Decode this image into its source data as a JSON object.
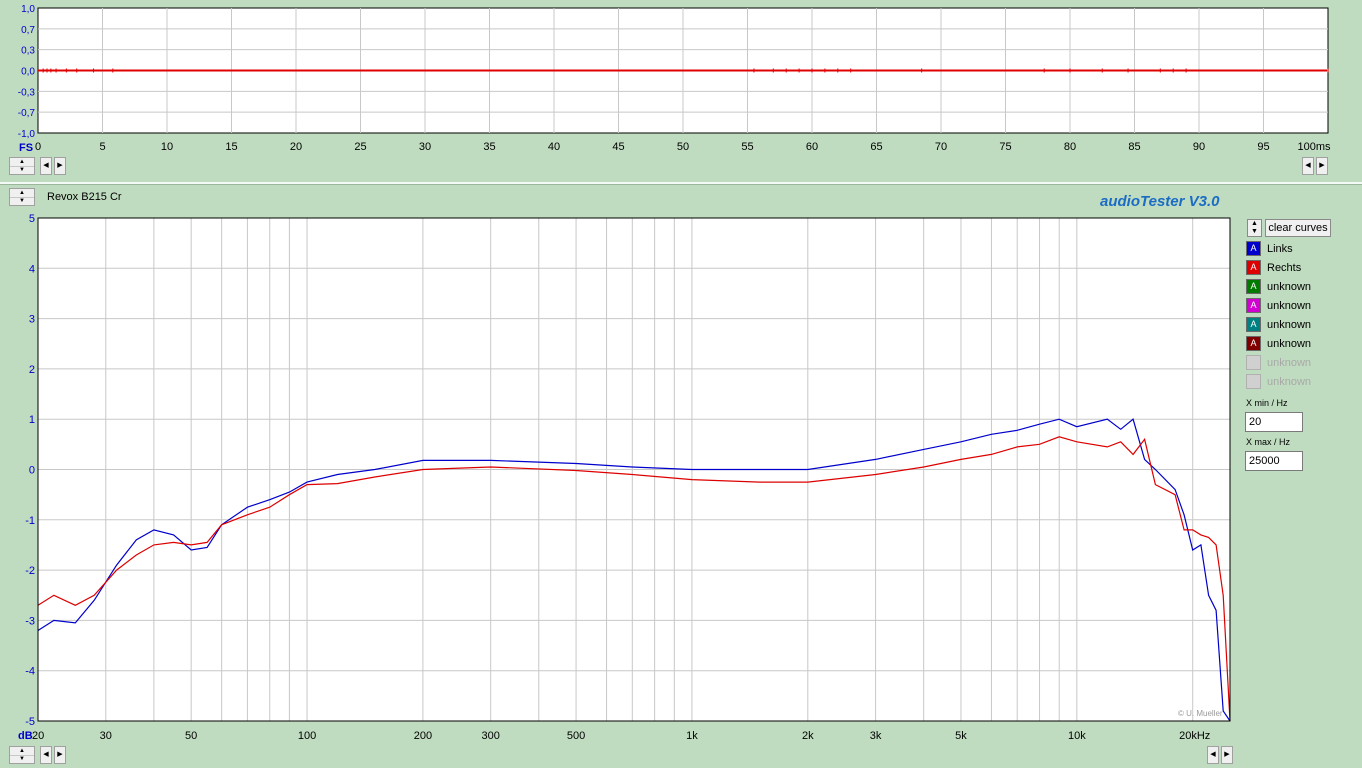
{
  "time_plot": {
    "y_unit": "FS",
    "x_unit": "ms",
    "y_ticks": [
      "1,0",
      "0,7",
      "0,3",
      "0,0",
      "-0,3",
      "-0,7",
      "-1,0"
    ],
    "x_ticks": [
      "0",
      "5",
      "10",
      "15",
      "20",
      "25",
      "30",
      "35",
      "40",
      "45",
      "50",
      "55",
      "60",
      "65",
      "70",
      "75",
      "80",
      "85",
      "90",
      "95",
      "100ms"
    ],
    "trace_color": "#e00000"
  },
  "file_name": "Revox B215 Cr",
  "brand": "audioTester  V3.0",
  "freq_plot": {
    "y_unit": "dB",
    "y_ticks": [
      "5",
      "4",
      "3",
      "2",
      "1",
      "0",
      "-1",
      "-2",
      "-3",
      "-4",
      "-5"
    ],
    "x_ticks": [
      "20",
      "30",
      "50",
      "100",
      "200",
      "300",
      "500",
      "1k",
      "2k",
      "3k",
      "5k",
      "10k",
      "20kHz"
    ],
    "copyright": "© U. Mueller"
  },
  "controls": {
    "clear_label": "clear curves",
    "xmin_label": "X min / Hz",
    "xmin_value": "20",
    "xmax_label": "X max / Hz",
    "xmax_value": "25000"
  },
  "legend": [
    {
      "label": "Links",
      "color": "#0000cc",
      "enabled": true
    },
    {
      "label": "Rechts",
      "color": "#dd0000",
      "enabled": true
    },
    {
      "label": "unknown",
      "color": "#007a00",
      "enabled": true
    },
    {
      "label": "unknown",
      "color": "#d000d0",
      "enabled": true
    },
    {
      "label": "unknown",
      "color": "#008080",
      "enabled": true
    },
    {
      "label": "unknown",
      "color": "#800000",
      "enabled": true
    },
    {
      "label": "unknown",
      "color": "#c0c0c0",
      "enabled": false
    },
    {
      "label": "unknown",
      "color": "#c0c0c0",
      "enabled": false
    }
  ],
  "chart_data": {
    "type": "line",
    "x_scale": "log",
    "xlim": [
      20,
      25000
    ],
    "ylim": [
      -5,
      5
    ],
    "grid": true,
    "series": [
      {
        "name": "Links",
        "color": "#0000cc",
        "x": [
          20,
          22,
          25,
          28,
          32,
          36,
          40,
          45,
          50,
          55,
          60,
          70,
          80,
          90,
          100,
          120,
          150,
          200,
          300,
          500,
          700,
          1000,
          1500,
          2000,
          3000,
          4000,
          5000,
          6000,
          7000,
          8000,
          9000,
          10000,
          12000,
          13000,
          14000,
          15000,
          16000,
          18000,
          19000,
          20000,
          21000,
          22000,
          23000,
          24000,
          25000
        ],
        "y": [
          -3.2,
          -3.0,
          -3.05,
          -2.6,
          -1.9,
          -1.4,
          -1.2,
          -1.3,
          -1.6,
          -1.55,
          -1.1,
          -0.75,
          -0.6,
          -0.45,
          -0.25,
          -0.1,
          0.0,
          0.18,
          0.18,
          0.12,
          0.05,
          0.0,
          0.0,
          0.0,
          0.2,
          0.4,
          0.55,
          0.7,
          0.78,
          0.9,
          1.0,
          0.85,
          1.0,
          0.8,
          1.0,
          0.2,
          0.0,
          -0.4,
          -0.9,
          -1.6,
          -1.5,
          -2.5,
          -2.8,
          -4.8,
          -5.0
        ]
      },
      {
        "name": "Rechts",
        "color": "#dd0000",
        "x": [
          20,
          22,
          25,
          28,
          32,
          36,
          40,
          45,
          50,
          55,
          60,
          70,
          80,
          90,
          100,
          120,
          150,
          200,
          300,
          500,
          700,
          1000,
          1500,
          2000,
          3000,
          4000,
          5000,
          6000,
          7000,
          8000,
          9000,
          10000,
          12000,
          13000,
          14000,
          15000,
          16000,
          18000,
          19000,
          20000,
          21000,
          22000,
          23000,
          24000,
          25000
        ],
        "y": [
          -2.7,
          -2.5,
          -2.7,
          -2.5,
          -2.0,
          -1.7,
          -1.5,
          -1.45,
          -1.5,
          -1.45,
          -1.1,
          -0.9,
          -0.75,
          -0.5,
          -0.3,
          -0.28,
          -0.15,
          0.0,
          0.05,
          -0.02,
          -0.1,
          -0.2,
          -0.25,
          -0.25,
          -0.1,
          0.05,
          0.2,
          0.3,
          0.45,
          0.5,
          0.65,
          0.55,
          0.45,
          0.55,
          0.3,
          0.6,
          -0.3,
          -0.5,
          -1.2,
          -1.2,
          -1.3,
          -1.35,
          -1.5,
          -2.5,
          -5.0
        ]
      }
    ]
  }
}
